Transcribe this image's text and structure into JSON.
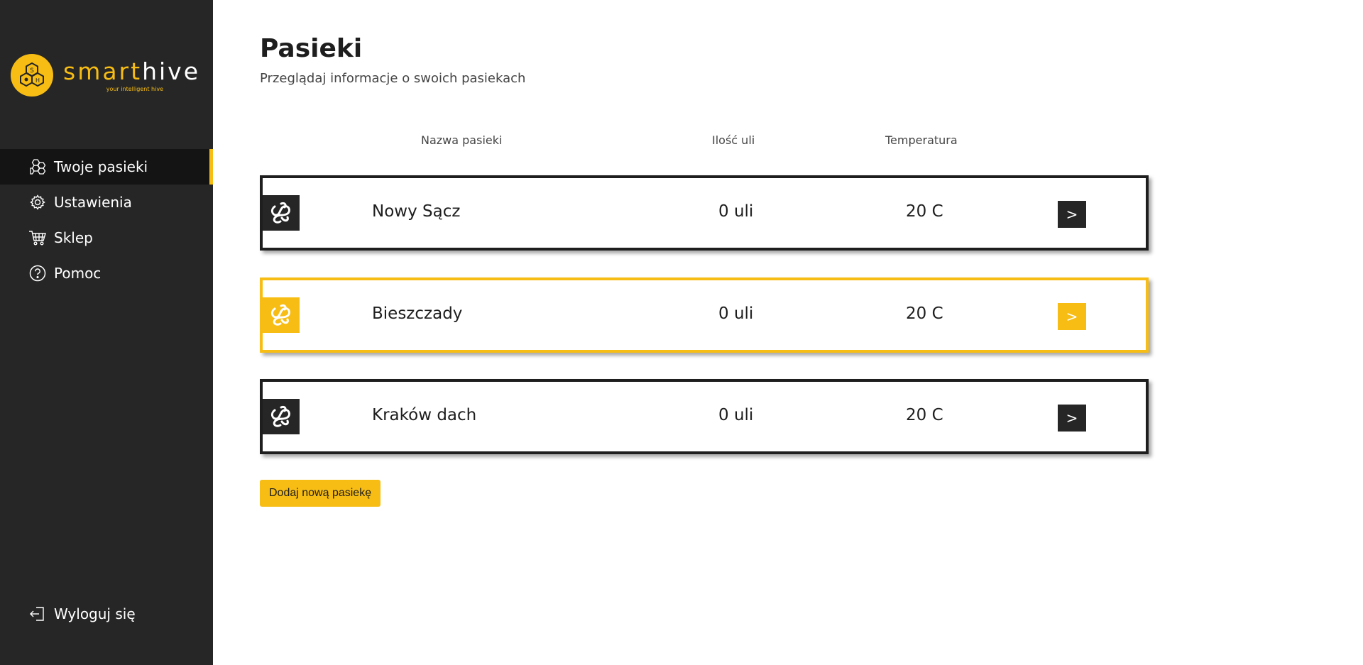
{
  "brand": {
    "name_part1": "smart",
    "name_part2": "hive",
    "tagline": "your intelligent hive",
    "accent_color": "#f7bd14",
    "dark_color": "#262626"
  },
  "sidebar": {
    "items": [
      {
        "label": "Twoje pasieki",
        "icon": "honeycomb-icon",
        "active": true
      },
      {
        "label": "Ustawienia",
        "icon": "gear-icon",
        "active": false
      },
      {
        "label": "Sklep",
        "icon": "cart-icon",
        "active": false
      },
      {
        "label": "Pomoc",
        "icon": "help-icon",
        "active": false
      }
    ],
    "logout_label": "Wyloguj się"
  },
  "page": {
    "title": "Pasieki",
    "subtitle": "Przeglądaj informacje o swoich pasiekach"
  },
  "table": {
    "headers": {
      "name": "Nazwa pasieki",
      "count": "Ilość uli",
      "temperature": "Temperatura"
    },
    "rows": [
      {
        "name": "Nowy Sącz",
        "count": "0 uli",
        "temperature": "20 C",
        "button": ">",
        "highlighted": false
      },
      {
        "name": "Bieszczady",
        "count": "0 uli",
        "temperature": "20 C",
        "button": ">",
        "highlighted": true
      },
      {
        "name": "Kraków dach",
        "count": "0 uli",
        "temperature": "20 C",
        "button": ">",
        "highlighted": false
      }
    ]
  },
  "add_button_label": "Dodaj nową pasiekę"
}
